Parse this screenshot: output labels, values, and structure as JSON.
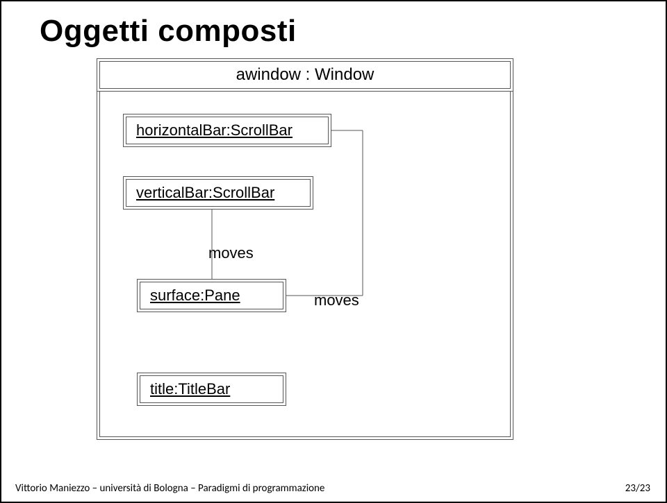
{
  "title": "Oggetti composti",
  "window": {
    "header": "awindow : Window",
    "horizontalBar": "horizontalBar:ScrollBar",
    "verticalBar": "verticalBar:ScrollBar",
    "surfacePane": "surface:Pane",
    "titleBar": "title:TitleBar"
  },
  "labels": {
    "moves_top": "moves",
    "moves_right": "moves"
  },
  "footer": {
    "left": "Vittorio Maniezzo – università di Bologna – Paradigmi di programmazione",
    "right": "23/23"
  }
}
